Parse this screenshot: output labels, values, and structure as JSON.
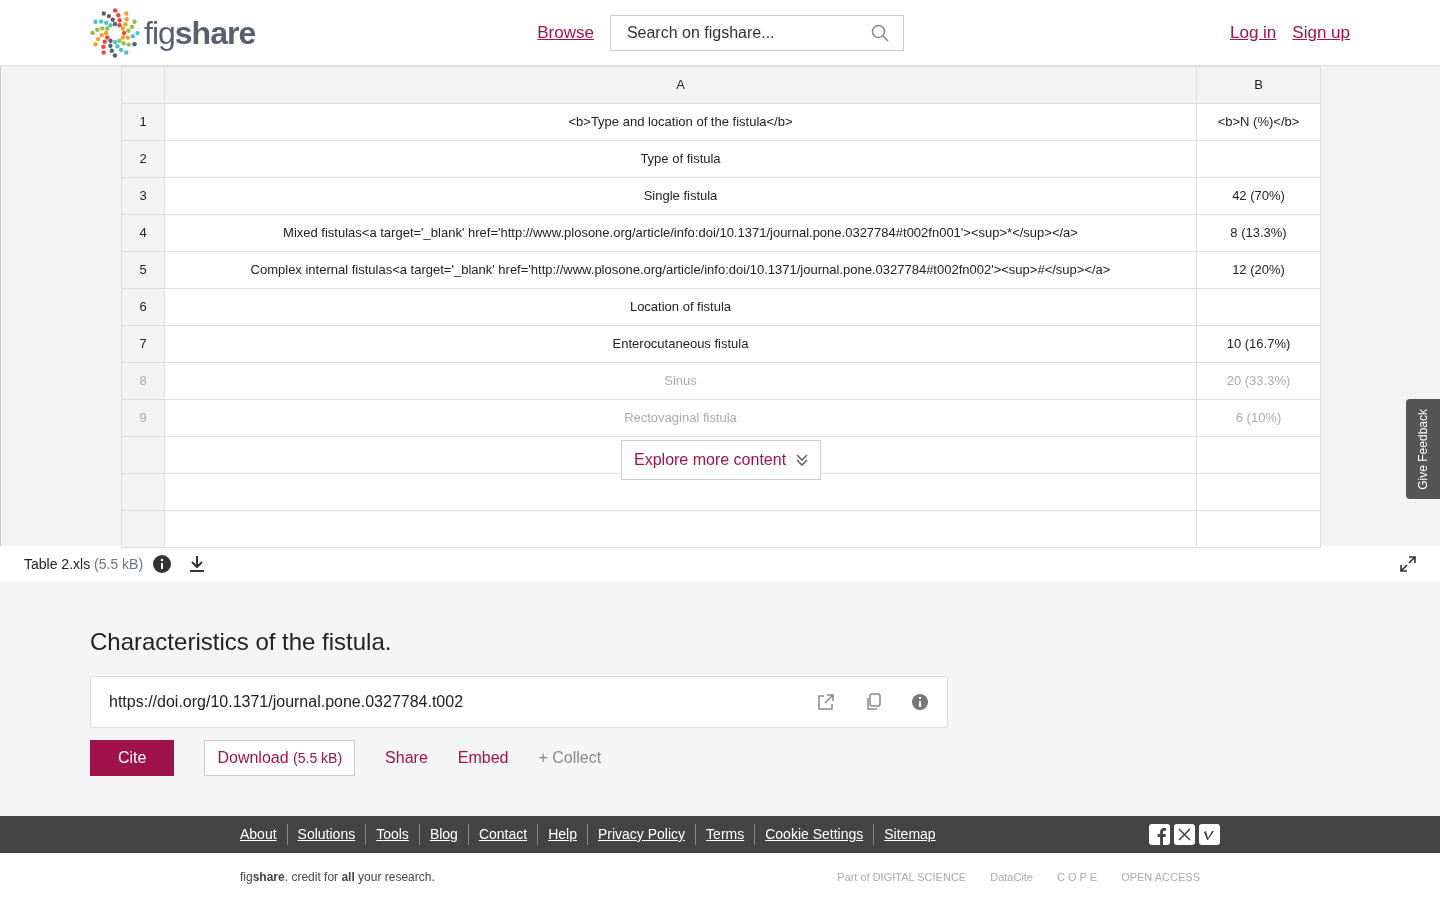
{
  "header": {
    "logo": "fig**share**",
    "nav_link": "Browse",
    "search": {
      "placeholder": "Search on figshare..."
    },
    "auth_links": [
      "Log in",
      "Sign up"
    ]
  },
  "preview": {
    "columns": [
      "A",
      "B"
    ],
    "rows": [
      {
        "num": "1",
        "a": "<b>Type and location of the fistula</b>",
        "b": "<b>N (%)</b>",
        "faded": false
      },
      {
        "num": "2",
        "a": "Type of fistula",
        "b": "",
        "faded": false
      },
      {
        "num": "3",
        "a": "Single fistula",
        "b": "42 (70%)",
        "faded": false
      },
      {
        "num": "4",
        "a": "Mixed fistulas<a target='_blank' href='http://www.plosone.org/article/info:doi/10.1371/journal.pone.0327784#t002fn001'><sup>*</sup></a>",
        "b": "8 (13.3%)",
        "faded": false
      },
      {
        "num": "5",
        "a": "Complex internal fistulas<a target='_blank' href='http://www.plosone.org/article/info:doi/10.1371/journal.pone.0327784#t002fn002'><sup>#</sup></a>",
        "b": "12 (20%)",
        "faded": false
      },
      {
        "num": "6",
        "a": "Location of fistula",
        "b": "",
        "faded": false
      },
      {
        "num": "7",
        "a": "Enterocutaneous fistula",
        "b": "10 (16.7%)",
        "faded": false
      },
      {
        "num": "8",
        "a": "Sinus",
        "b": "20 (33.3%)",
        "faded": true
      },
      {
        "num": "9",
        "a": "Rectovaginal fistula",
        "b": "6 (10%)",
        "faded": true
      }
    ],
    "explore_button": "Explore more content",
    "feedback_tab": "Give Feedback",
    "file": {
      "name": "Table 2.xls",
      "size": "(5.5 kB)"
    }
  },
  "item": {
    "title": "Characteristics of the fistula.",
    "doi": "https://doi.org/10.1371/journal.pone.0327784.t002",
    "actions": [
      {
        "kind": "primary",
        "label": "Cite"
      },
      {
        "kind": "outline",
        "label": "Download",
        "extra": "(5.5 kB)"
      },
      {
        "kind": "link",
        "label": "Share"
      },
      {
        "kind": "link",
        "label": "Embed"
      },
      {
        "kind": "muted",
        "label": "+ Collect"
      }
    ]
  },
  "footer": {
    "links": [
      "About",
      "Solutions",
      "Tools",
      "Blog",
      "Contact",
      "Help",
      "Privacy Policy",
      "Terms",
      "Cookie Settings",
      "Sitemap"
    ],
    "tagline": "fig**share**. credit for **all** your research.",
    "partner_logos": [
      "Part of DIGITAL SCIENCE",
      "DataCite",
      "C O P E",
      "OPEN ACCESS"
    ]
  }
}
